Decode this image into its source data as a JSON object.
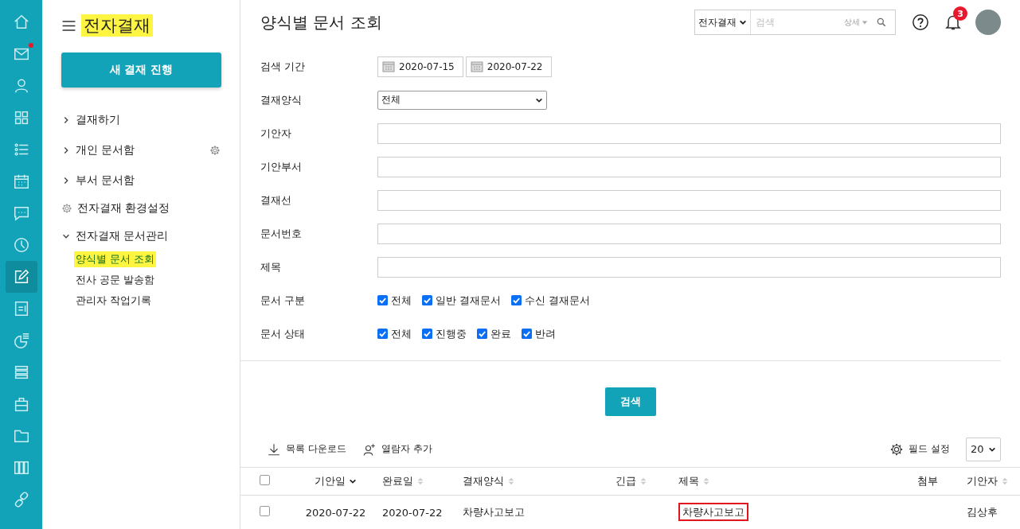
{
  "rail": [
    {
      "kind": "home",
      "selected": false,
      "dot": false
    },
    {
      "kind": "mail",
      "selected": false,
      "dot": true
    },
    {
      "kind": "person",
      "selected": false,
      "dot": false
    },
    {
      "kind": "grid",
      "selected": false,
      "dot": false
    },
    {
      "kind": "list",
      "selected": false,
      "dot": false
    },
    {
      "kind": "calendar",
      "selected": false,
      "dot": false
    },
    {
      "kind": "chat",
      "selected": false,
      "dot": false
    },
    {
      "kind": "clock",
      "selected": false,
      "dot": false
    },
    {
      "kind": "edit",
      "selected": true,
      "dot": false
    },
    {
      "kind": "note",
      "selected": false,
      "dot": false
    },
    {
      "kind": "pie",
      "selected": false,
      "dot": false
    },
    {
      "kind": "stack",
      "selected": false,
      "dot": false
    },
    {
      "kind": "briefcase",
      "selected": false,
      "dot": false
    },
    {
      "kind": "folder",
      "selected": false,
      "dot": false
    },
    {
      "kind": "binders",
      "selected": false,
      "dot": false
    },
    {
      "kind": "link",
      "selected": false,
      "dot": false
    }
  ],
  "sidebar": {
    "title": "전자결재",
    "new_button": "새 결재 진행",
    "items": [
      {
        "kind": "folder",
        "label": "결재하기",
        "expanded": false,
        "gear": false
      },
      {
        "kind": "folder",
        "label": "개인 문서함",
        "expanded": false,
        "gear": true
      },
      {
        "kind": "folder",
        "label": "부서 문서함",
        "expanded": false,
        "gear": false
      },
      {
        "kind": "setting",
        "label": "전자결재 환경설정",
        "gear": false
      },
      {
        "kind": "folder",
        "label": "전자결재 문서관리",
        "expanded": true,
        "gear": false,
        "children": [
          {
            "label": "양식별 문서 조회",
            "selected": true
          },
          {
            "label": "전사 공문 발송함",
            "selected": false
          },
          {
            "label": "관리자 작업기록",
            "selected": false
          }
        ]
      }
    ]
  },
  "header": {
    "title": "양식별 문서 조회",
    "search_scope": "전자결재",
    "search_placeholder": "검색",
    "detail": "상세",
    "notification_count": "3"
  },
  "form": [
    {
      "kind": "dates",
      "label": "검색 기간",
      "values": [
        "2020-07-15",
        "2020-07-22"
      ]
    },
    {
      "kind": "select",
      "label": "결재양식",
      "value": "전체"
    },
    {
      "kind": "text",
      "label": "기안자"
    },
    {
      "kind": "text",
      "label": "기안부서"
    },
    {
      "kind": "text",
      "label": "결재선"
    },
    {
      "kind": "text",
      "label": "문서번호"
    },
    {
      "kind": "text",
      "label": "제목"
    },
    {
      "kind": "checks",
      "label": "문서 구분",
      "options": [
        {
          "label": "전체",
          "checked": true
        },
        {
          "label": "일반 결재문서",
          "checked": true
        },
        {
          "label": "수신 결재문서",
          "checked": true
        }
      ]
    },
    {
      "kind": "checks",
      "label": "문서 상태",
      "options": [
        {
          "label": "전체",
          "checked": true
        },
        {
          "label": "진행중",
          "checked": true
        },
        {
          "label": "완료",
          "checked": true
        },
        {
          "label": "반려",
          "checked": true
        }
      ]
    }
  ],
  "search_button": "검색",
  "toolbar": {
    "download": "목록 다운로드",
    "add_viewer": "열람자 추가",
    "field_settings": "필드 설정",
    "page_size": "20"
  },
  "table": {
    "select_all": false,
    "columns": [
      {
        "label": "기안일",
        "sortable": true,
        "sorted": true
      },
      {
        "label": "완료일",
        "sortable": true,
        "sorted": false
      },
      {
        "label": "결재양식",
        "sortable": true,
        "sorted": false
      },
      {
        "label": "긴급",
        "sortable": true,
        "sorted": false
      },
      {
        "label": "제목",
        "sortable": true,
        "sorted": false
      },
      {
        "label": "첨부",
        "sortable": false
      },
      {
        "label": "기안자",
        "sortable": true,
        "sorted": false
      }
    ],
    "rows": [
      {
        "selected": false,
        "drafted": "2020-07-22",
        "completed": "2020-07-22",
        "form": "차량사고보고",
        "title": "차량사고보고",
        "title_boxed": true,
        "drafter": "김상후"
      }
    ]
  }
}
